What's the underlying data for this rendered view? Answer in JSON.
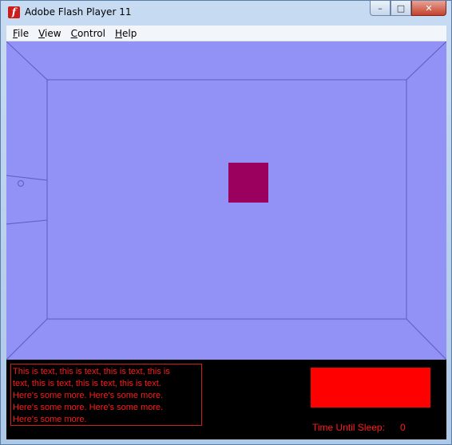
{
  "window": {
    "title": "Adobe Flash Player 11"
  },
  "caption": {
    "minimize": "–",
    "maximize": "□",
    "close": "✕"
  },
  "menu": {
    "file": "ile",
    "file_key": "F",
    "view": "iew",
    "view_key": "V",
    "control": "ontrol",
    "control_key": "C",
    "help": "elp",
    "help_key": "H"
  },
  "colors": {
    "stage_bg": "#9191f6",
    "stage_lines": "#5d5dbd",
    "square": "#9b005e",
    "text_red": "#ff1b1b",
    "red_box": "#ff0000"
  },
  "log": {
    "text": "This is text, this is text, this is text,  this is\ntext, this is text,  this is text, this is text.\nHere's some more. Here's some more.\nHere's some more. Here's some more.\nHere's some more."
  },
  "status": {
    "sleep_label": "Time Until Sleep:",
    "sleep_value": "0"
  }
}
